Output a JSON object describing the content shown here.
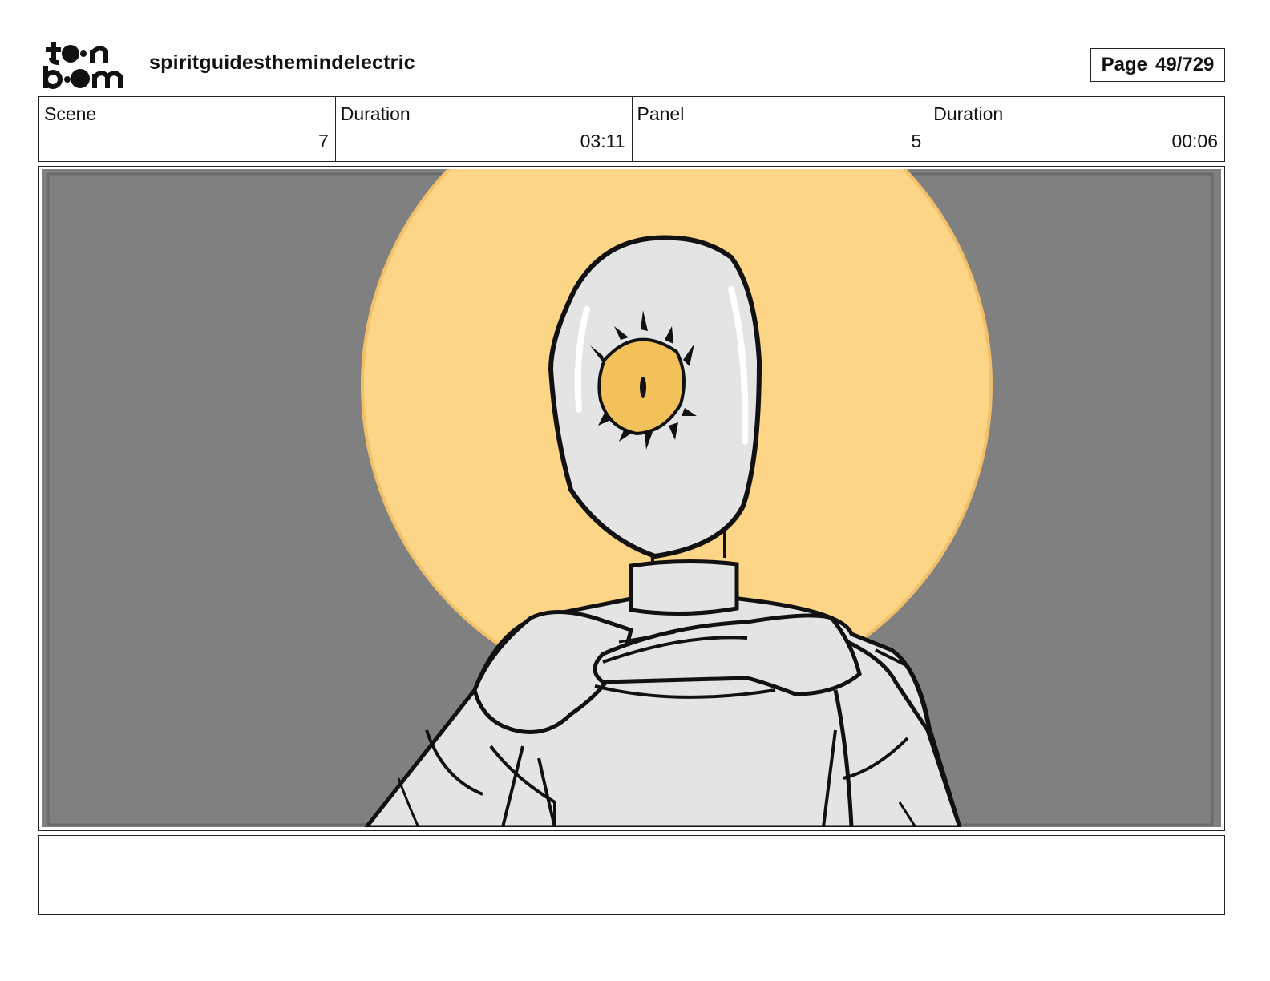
{
  "header": {
    "logo": {
      "line1": "toon",
      "line2": "boom"
    },
    "project_name": "spiritguidesthemindelectric",
    "page_label": "Page",
    "page_number": "49/729"
  },
  "meta": {
    "scene_label": "Scene",
    "scene_value": "7",
    "scene_duration_label": "Duration",
    "scene_duration_value": "03:11",
    "panel_label": "Panel",
    "panel_value": "5",
    "panel_duration_label": "Duration",
    "panel_duration_value": "00:06"
  },
  "colors": {
    "background_gray": "#808080",
    "halo": "#fdd587",
    "halo_edge": "#f3c06a",
    "eye": "#f3c15a",
    "figure_fill": "#e4e4e4",
    "line": "#111111"
  },
  "notes": {
    "text": ""
  }
}
